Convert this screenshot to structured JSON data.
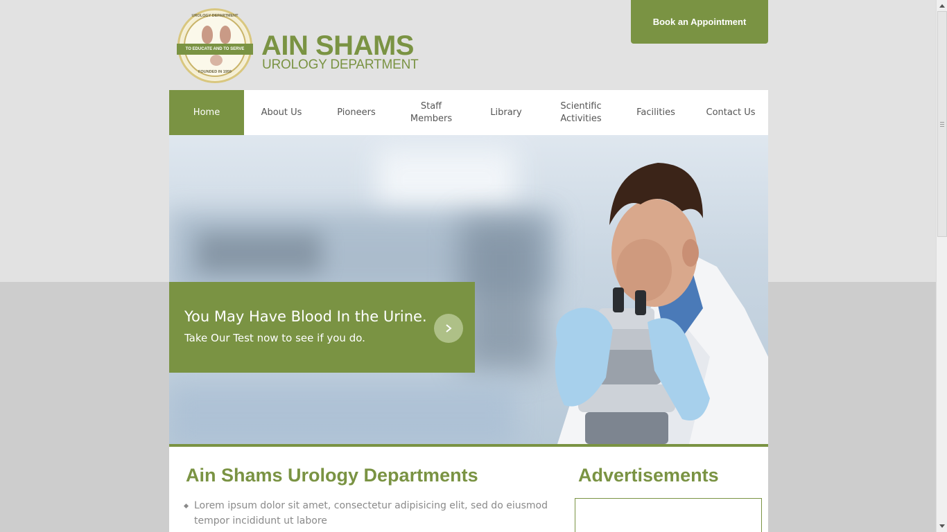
{
  "header": {
    "brand_name": "AIN SHAMS",
    "brand_subtitle": "UROLOGY DEPARTMENT",
    "seal_top_text": "UROLOGY DEPARTMENT",
    "seal_ribbon_text": "TO EDUCATE AND TO SERVE",
    "seal_bottom_text": "FOUNDED IN 1959",
    "book_button_label": "Book an Appointment"
  },
  "nav": {
    "items": [
      {
        "label": "Home",
        "active": true
      },
      {
        "label": "About Us",
        "active": false
      },
      {
        "label": "Pioneers",
        "active": false
      },
      {
        "label": "Staff\nMembers",
        "active": false
      },
      {
        "label": "Library",
        "active": false
      },
      {
        "label": "Scientific\nActivities",
        "active": false
      },
      {
        "label": "Facilities",
        "active": false
      },
      {
        "label": "Contact Us",
        "active": false
      }
    ]
  },
  "hero": {
    "title": "You May Have Blood In the Urine.",
    "subtitle": "Take Our Test now to see if you do."
  },
  "main": {
    "title": "Ain Shams Urology Departments",
    "list": [
      "Lorem ipsum dolor sit amet, consectetur adipisicing elit, sed do eiusmod tempor incididunt ut labore"
    ]
  },
  "sidebar": {
    "title": "Advertisements"
  },
  "colors": {
    "accent": "#7a9343",
    "page_bg_top": "#e2e2e2",
    "page_bg_bottom": "#cdcdcd"
  }
}
